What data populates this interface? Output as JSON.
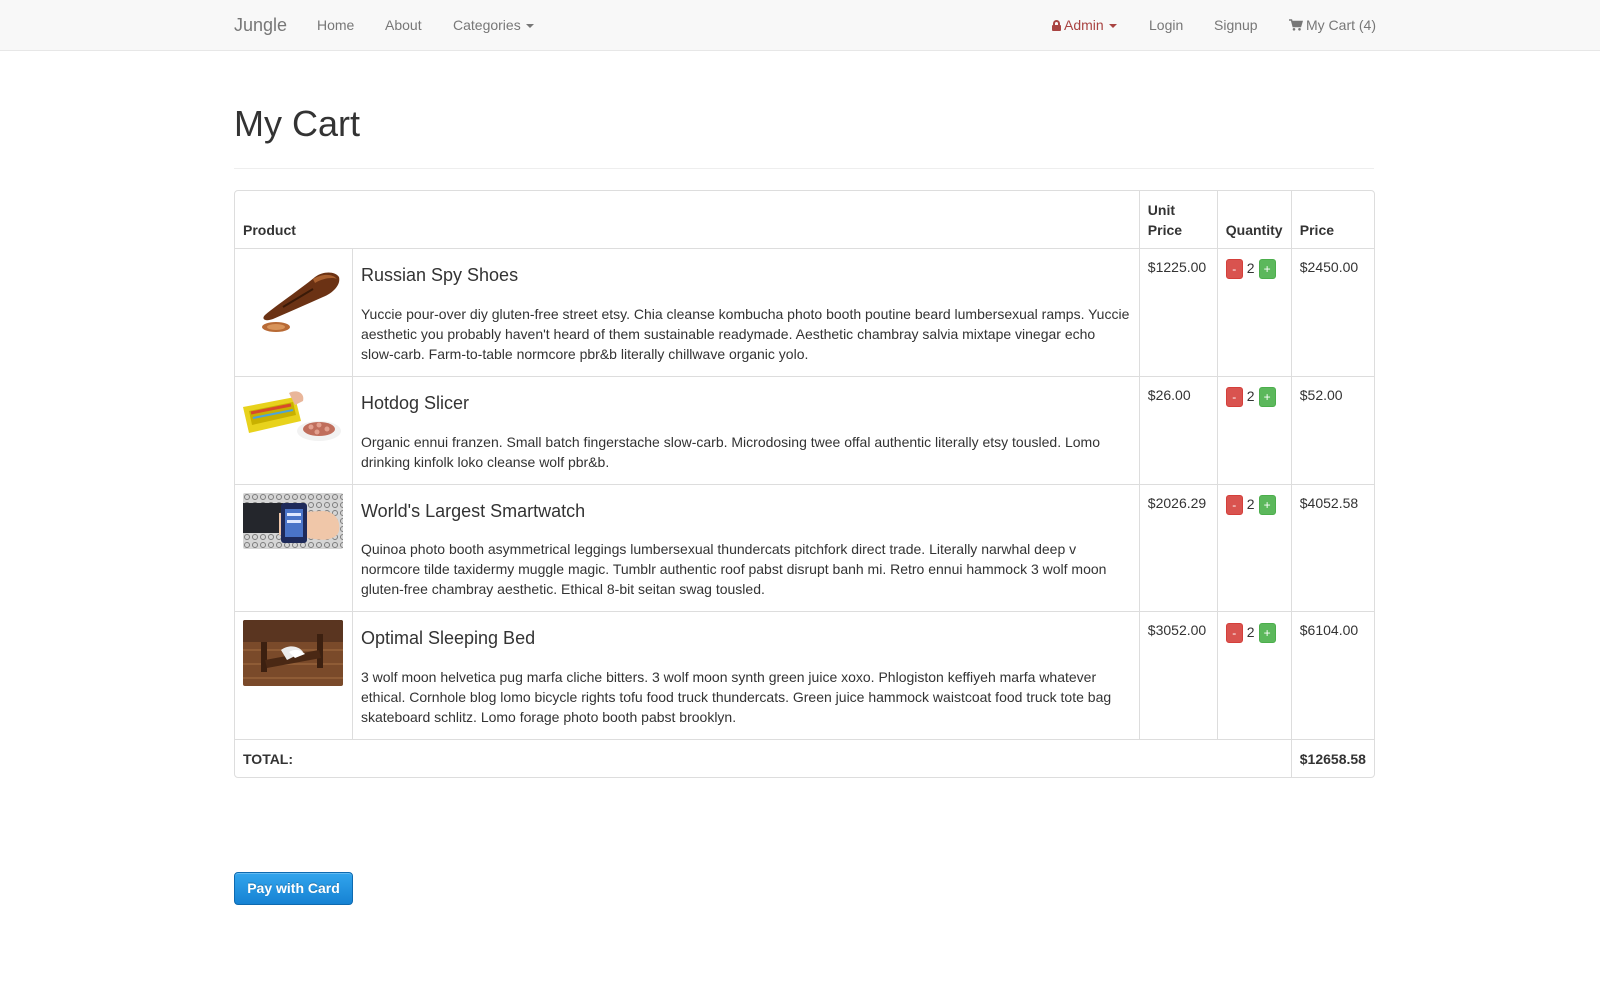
{
  "navbar": {
    "brand": "Jungle",
    "links": {
      "home": "Home",
      "about": "About",
      "categories": "Categories",
      "admin": "Admin",
      "login": "Login",
      "signup": "Signup",
      "cart": "My Cart (4)"
    },
    "colors": {
      "background": "#f8f8f8",
      "text": "#777777",
      "admin": "#a94442"
    }
  },
  "page": {
    "title": "My Cart"
  },
  "table": {
    "headers": {
      "product": "Product",
      "unit_price": "Unit Price",
      "quantity": "Quantity",
      "price": "Price"
    },
    "items": [
      {
        "image_icon": "shoes-photo",
        "name": "Russian Spy Shoes",
        "description": "Yuccie pour-over diy gluten-free street etsy. Chia cleanse kombucha photo booth poutine beard lumbersexual ramps. Yuccie aesthetic you probably haven't heard of them sustainable readymade. Aesthetic chambray salvia mixtape vinegar echo slow-carb. Farm-to-table normcore pbr&b literally chillwave organic yolo.",
        "unit_price": "$1225.00",
        "quantity": "2",
        "price": "$2450.00"
      },
      {
        "image_icon": "hotdog-slicer-photo",
        "name": "Hotdog Slicer",
        "description": "Organic ennui franzen. Small batch fingerstache slow-carb. Microdosing twee offal authentic literally etsy tousled. Lomo drinking kinfolk loko cleanse wolf pbr&b.",
        "unit_price": "$26.00",
        "quantity": "2",
        "price": "$52.00"
      },
      {
        "image_icon": "smartwatch-photo",
        "name": "World's Largest Smartwatch",
        "description": "Quinoa photo booth asymmetrical leggings lumbersexual thundercats pitchfork direct trade. Literally narwhal deep v normcore tilde taxidermy muggle magic. Tumblr authentic roof pabst disrupt banh mi. Retro ennui hammock 3 wolf moon gluten-free chambray aesthetic. Ethical 8-bit seitan swag tousled.",
        "unit_price": "$2026.29",
        "quantity": "2",
        "price": "$4052.58"
      },
      {
        "image_icon": "sleeping-bed-photo",
        "name": "Optimal Sleeping Bed",
        "description": "3 wolf moon helvetica pug marfa cliche bitters. 3 wolf moon synth green juice xoxo. Phlogiston keffiyeh marfa whatever ethical. Cornhole blog lomo bicycle rights tofu food truck thundercats. Green juice hammock waistcoat food truck tote bag skateboard schlitz. Lomo forage photo booth pabst brooklyn.",
        "unit_price": "$3052.00",
        "quantity": "2",
        "price": "$6104.00"
      }
    ],
    "qty_minus": "-",
    "qty_plus": "+",
    "total_label": "TOTAL:",
    "total_value": "$12658.58"
  },
  "pay_button": {
    "label": "Pay with Card",
    "color": "#1c8fe0"
  },
  "colors": {
    "minus": "#d9534f",
    "plus": "#5cb85c",
    "border": "#dddddd"
  }
}
